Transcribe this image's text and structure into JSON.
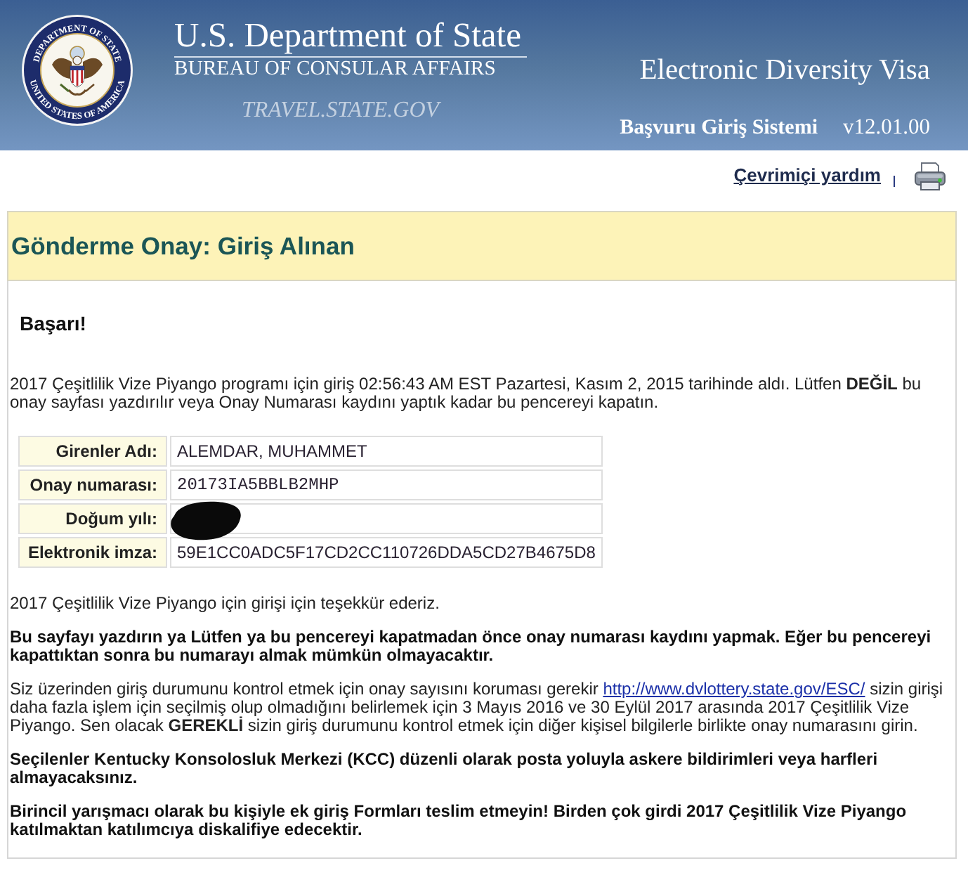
{
  "header": {
    "seal_text": [
      "DEPARTMENT OF STATE",
      "UNITED STATES OF AMERICA"
    ],
    "title": "U.S. Department of State",
    "subtitle": "BUREAU OF CONSULAR AFFAIRS",
    "website": "TRAVEL.STATE.GOV",
    "app_name": "Electronic Diversity Visa",
    "system_name": "Başvuru Giriş Sistemi",
    "version": "v12.01.00"
  },
  "toolbar": {
    "help_link": "Çevrimiçi yardım"
  },
  "banner": {
    "title": "Gönderme Onay: Giriş Alınan"
  },
  "content": {
    "heading": "Başarı!",
    "intro": "2017 Çeşitlilik Vize Piyango programı için giriş 02:56:43 AM EST Pazartesi, Kasım 2, 2015 tarihinde aldı. Lütfen **DEĞİL** bu onay sayfası yazdırılır veya Onay Numarası kaydını yaptık kadar bu pencereyi kapatın.",
    "details": [
      {
        "label": "Girenler Adı:",
        "kind": "text",
        "value": "ALEMDAR, MUHAMMET"
      },
      {
        "label": "Onay numarası:",
        "kind": "code",
        "value": "20173IA5BBLB2MHP"
      },
      {
        "label": "Doğum yılı:",
        "kind": "redacted"
      },
      {
        "label": "Elektronik imza:",
        "kind": "text",
        "value": "59E1CC0ADC5F17CD2CC110726DDA5CD27B4675D8"
      }
    ],
    "thanks": "2017 Çeşitlilik Vize Piyango için girişi için teşekkür ederiz.",
    "print_warning": "Bu sayfayı yazdırın ya Lütfen ya bu pencereyi kapatmadan önce onay numarası kaydını yapmak. Eğer bu pencereyi kapattıktan sonra bu numarayı almak mümkün olmayacaktır.",
    "status_check": {
      "before": "Siz üzerinden giriş durumunu kontrol etmek için onay sayısını koruması gerekir",
      "link": "http://www.dvlottery.state.gov/ESC/",
      "after": "sizin girişi daha fazla işlem için seçilmiş olup olmadığını belirlemek için 3 Mayıs 2016 ve 30 Eylül 2017 arasında 2017 Çeşitlilik Vize Piyango. Sen olacak **GEREKLİ** sizin giriş durumunu kontrol etmek için diğer kişisel bilgilerle birlikte onay numarasını girin."
    },
    "mail_notice": "Seçilenler Kentucky Konsolosluk Merkezi (KCC) düzenli olarak posta yoluyla askere bildirimleri veya harfleri almayacaksınız.",
    "duplicate_warning": "Birincil yarışmacı olarak bu kişiyle ek giriş Formları teslim etmeyin! Birden çok girdi 2017 Çeşitlilik Vize Piyango katılmaktan katılımcıya diskalifiye edecektir."
  }
}
